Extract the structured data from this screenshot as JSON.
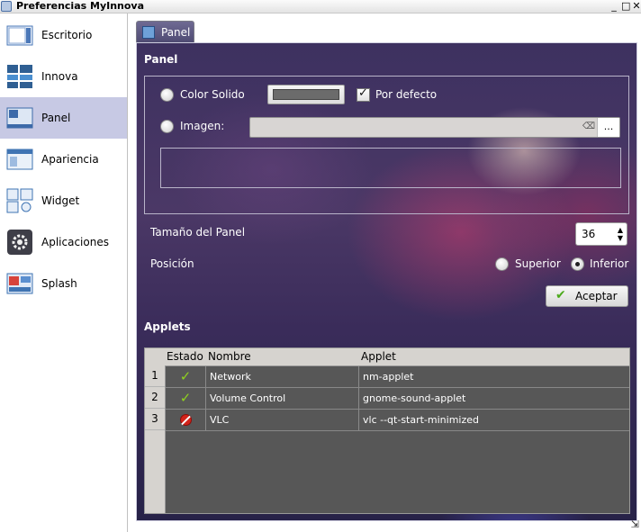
{
  "window": {
    "title": "Preferencias MyInnova",
    "controls": [
      "_",
      "□",
      "✕"
    ]
  },
  "sidebar": {
    "items": [
      {
        "label": "Escritorio",
        "icon": "desktop-icon"
      },
      {
        "label": "Innova",
        "icon": "innova-icon"
      },
      {
        "label": "Panel",
        "icon": "panel-icon",
        "selected": true
      },
      {
        "label": "Apariencia",
        "icon": "appearance-icon"
      },
      {
        "label": "Widget",
        "icon": "widget-icon"
      },
      {
        "label": "Aplicaciones",
        "icon": "applications-icon"
      },
      {
        "label": "Splash",
        "icon": "splash-icon"
      }
    ]
  },
  "tab": {
    "label": "Panel"
  },
  "panel_section": {
    "heading": "Panel",
    "color_solido_label": "Color Solido",
    "color_swatch": "#6b6b6b",
    "por_defecto_label": "Por defecto",
    "por_defecto_checked": true,
    "imagen_label": "Imagen:",
    "imagen_value": "",
    "more_button": "..."
  },
  "size": {
    "label": "Tamaño del Panel",
    "value": "36"
  },
  "position": {
    "label": "Posición",
    "superior": "Superior",
    "inferior": "Inferior",
    "selected": "Inferior"
  },
  "accept_button": {
    "label": "Aceptar"
  },
  "applets": {
    "heading": "Applets",
    "columns": [
      "Estado",
      "Nombre",
      "Applet"
    ],
    "rows": [
      {
        "num": "1",
        "status": "enabled",
        "name": "Network",
        "applet": "nm-applet"
      },
      {
        "num": "2",
        "status": "enabled",
        "name": "Volume Control",
        "applet": "gnome-sound-applet"
      },
      {
        "num": "3",
        "status": "disabled",
        "name": "VLC",
        "applet": "vlc --qt-start-minimized"
      }
    ]
  }
}
